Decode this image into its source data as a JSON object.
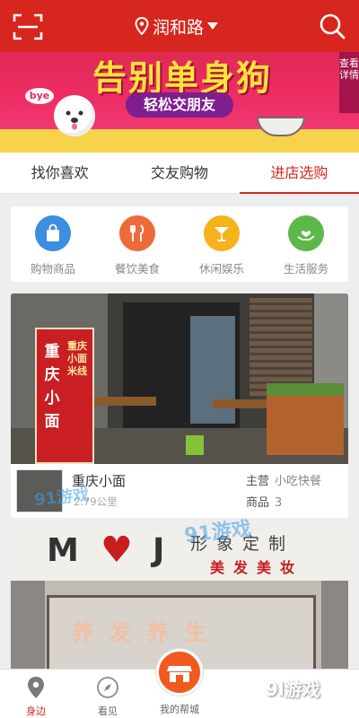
{
  "header": {
    "location": "润和路",
    "scan_icon": "scan-icon",
    "search_icon": "search-icon",
    "bg_color": "#d7261d"
  },
  "banner": {
    "title": "告别单身狗",
    "subtitle": "轻松交朋友",
    "detail": "查看详情",
    "bye": "bye"
  },
  "tabs": [
    {
      "label": "找你喜欢",
      "active": false
    },
    {
      "label": "交友购物",
      "active": false
    },
    {
      "label": "进店选购",
      "active": true
    }
  ],
  "categories": [
    {
      "label": "购物商品",
      "icon": "shopping-bag-icon",
      "color": "#3b8ee0"
    },
    {
      "label": "餐饮美食",
      "icon": "fork-knife-icon",
      "color": "#ef6a3a"
    },
    {
      "label": "休闲娱乐",
      "icon": "cocktail-icon",
      "color": "#f6b21c"
    },
    {
      "label": "生活服务",
      "icon": "hand-heart-icon",
      "color": "#5cb848"
    }
  ],
  "shops": [
    {
      "name": "重庆小面",
      "distance": "2.79公里",
      "main_label": "主营",
      "main_value": "小吃快餐",
      "goods_label": "商品",
      "goods_value": "3",
      "sign_text": "重庆小面",
      "sign_side": "重庆小面米线"
    },
    {
      "sign_m": "M",
      "sign_j": "J",
      "sign_line1": "形象定制",
      "sign_line2": "美发美妆",
      "store_text": "养发养生"
    }
  ],
  "bottom_nav": [
    {
      "label": "身边",
      "icon": "location-pin-icon",
      "active": true
    },
    {
      "label": "看见",
      "icon": "compass-icon",
      "active": false
    },
    {
      "label": "我的帮城",
      "icon": "shop-icon",
      "active": false
    }
  ],
  "watermark": {
    "text1": "91游戏",
    "text2": "91游戏",
    "text3": "9l游戏"
  }
}
